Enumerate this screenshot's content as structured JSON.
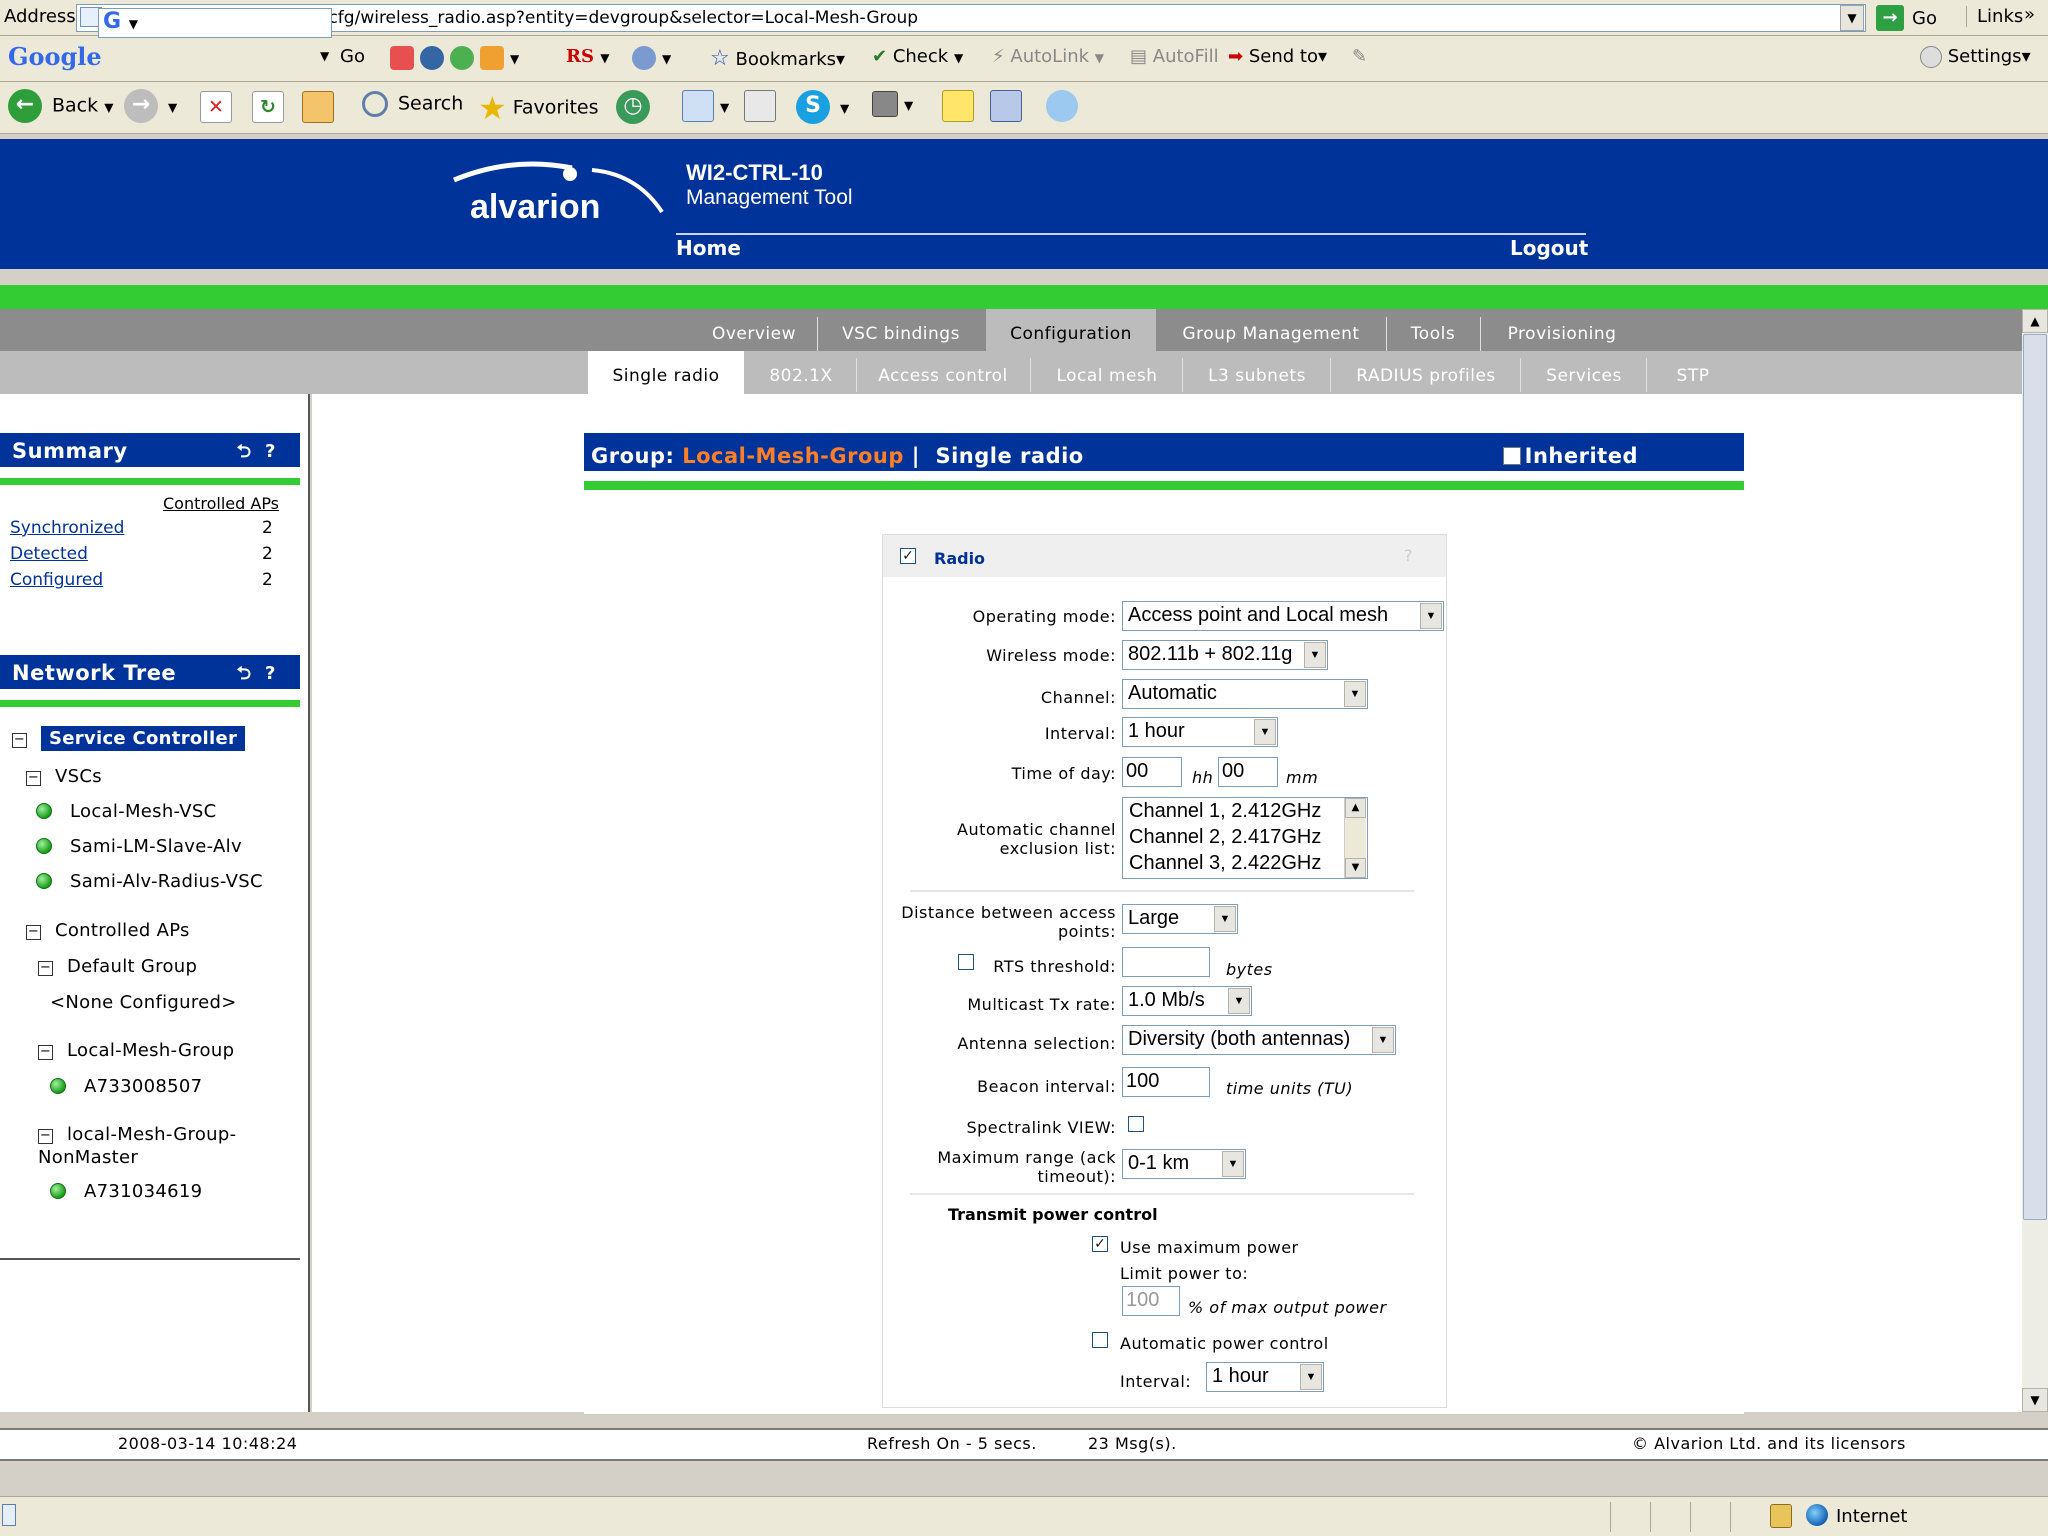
{
  "browser": {
    "address_label": "Address",
    "url": "https://172.16.0.170/centcfg/wireless_radio.asp?entity=devgroup&selector=Local-Mesh-Group",
    "go_label": "Go",
    "links_label": "Links",
    "links_chevron": "»",
    "google": {
      "logo": "Google",
      "search_value": "G",
      "go_label": "Go",
      "rs_label": "RS",
      "bookmarks_label": "Bookmarks",
      "check_label": "Check",
      "autolink_label": "AutoLink",
      "autofill_label": "AutoFill",
      "sendto_label": "Send to",
      "settings_label": "Settings"
    },
    "toolbar": {
      "back_label": "Back",
      "search_label": "Search",
      "favorites_label": "Favorites"
    },
    "status": {
      "zone_label": "Internet"
    }
  },
  "app": {
    "logo_text": "alvarion",
    "product_name": "WI2-CTRL-10",
    "product_sub": "Management Tool",
    "nav_home": "Home",
    "nav_logout": "Logout"
  },
  "tabs_main": [
    {
      "label": "Overview"
    },
    {
      "label": "VSC bindings"
    },
    {
      "label": "Configuration"
    },
    {
      "label": "Group Management"
    },
    {
      "label": "Tools"
    },
    {
      "label": "Provisioning"
    }
  ],
  "tabs_sub": [
    {
      "label": "Single radio"
    },
    {
      "label": "802.1X"
    },
    {
      "label": "Access control"
    },
    {
      "label": "Local mesh"
    },
    {
      "label": "L3 subnets"
    },
    {
      "label": "RADIUS profiles"
    },
    {
      "label": "Services"
    },
    {
      "label": "STP"
    }
  ],
  "summary": {
    "title": "Summary",
    "column_header": "Controlled APs",
    "rows": [
      {
        "label": "Synchronized",
        "value": "2"
      },
      {
        "label": "Detected",
        "value": "2"
      },
      {
        "label": "Configured",
        "value": "2"
      }
    ]
  },
  "network_tree": {
    "title": "Network Tree",
    "service_controller": "Service Controller",
    "vscs_label": "VSCs",
    "vscs": [
      "Local-Mesh-VSC",
      "Sami-LM-Slave-Alv",
      "Sami-Alv-Radius-VSC"
    ],
    "controlled_aps_label": "Controlled APs",
    "default_group": "Default Group",
    "none_configured": "<None Configured>",
    "group1": "Local-Mesh-Group",
    "group1_ap": "A733008507",
    "group2_line1": "local-Mesh-Group-",
    "group2_line2": "NonMaster",
    "group2_ap": "A731034619"
  },
  "panel_icons": {
    "refresh": "⮌",
    "help": "?"
  },
  "group": {
    "prefix": "Group:",
    "name": "Local-Mesh-Group",
    "separator": "|",
    "page": "Single radio",
    "inherited_label": "Inherited"
  },
  "radio": {
    "title": "Radio",
    "help": "?",
    "operating_mode_label": "Operating mode:",
    "operating_mode_value": "Access point and Local mesh",
    "wireless_mode_label": "Wireless mode:",
    "wireless_mode_value": "802.11b + 802.11g",
    "channel_label": "Channel:",
    "channel_value": "Automatic",
    "interval_label": "Interval:",
    "interval_value": "1 hour",
    "time_of_day_label": "Time of day:",
    "time_hh": "00",
    "time_hh_unit": "hh",
    "time_mm": "00",
    "time_mm_unit": "mm",
    "exclusion_label_1": "Automatic channel",
    "exclusion_label_2": "exclusion list:",
    "exclusion_options": [
      "Channel 1, 2.412GHz",
      "Channel 2, 2.417GHz",
      "Channel 3, 2.422GHz"
    ],
    "distance_label_1": "Distance between access",
    "distance_label_2": "points:",
    "distance_value": "Large",
    "rts_label": "RTS threshold:",
    "rts_value": "",
    "rts_unit": "bytes",
    "multicast_label": "Multicast Tx rate:",
    "multicast_value": "1.0 Mb/s",
    "antenna_label": "Antenna selection:",
    "antenna_value": "Diversity (both antennas)",
    "beacon_label": "Beacon interval:",
    "beacon_value": "100",
    "beacon_unit": "time units (TU)",
    "spectralink_label": "Spectralink VIEW:",
    "max_range_label_1": "Maximum range (ack",
    "max_range_label_2": "timeout):",
    "max_range_value": "0-1 km",
    "tpc_title": "Transmit power control",
    "use_max_power_label": "Use maximum power",
    "limit_power_label": "Limit power to:",
    "limit_power_value": "100",
    "limit_power_unit": "% of max output power",
    "auto_power_label": "Automatic power control",
    "auto_interval_label": "Interval:",
    "auto_interval_value": "1 hour"
  },
  "footer": {
    "timestamp": "2008-03-14 10:48:24",
    "refresh": "Refresh On - 5 secs.",
    "messages": "23 Msg(s).",
    "copyright": "© Alvarion Ltd. and its licensors"
  },
  "colors": {
    "header_blue": "#003399",
    "accent_green": "#33cc33",
    "group_orange": "#ff7f27"
  }
}
